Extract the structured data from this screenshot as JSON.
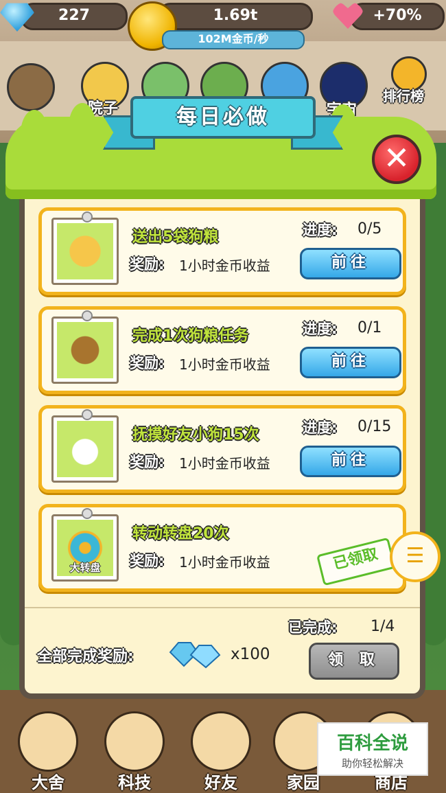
{
  "top": {
    "diamonds": "227",
    "coins": "1.69t",
    "rate": "102M金币/秒",
    "bonus": "+70%"
  },
  "side": {
    "left_label": "院子",
    "right_label": "宇宙",
    "ranking_label": "排行榜"
  },
  "dialog": {
    "title": "每日必做",
    "close_glyph": "✕"
  },
  "tasks": [
    {
      "title": "送出5袋狗粮",
      "reward_label": "奖励:",
      "reward": "1小时金币收益",
      "progress_label": "进度:",
      "progress": "0/5",
      "action": "前往",
      "icon": "dog-food-bags-icon"
    },
    {
      "title": "完成1次狗粮任务",
      "reward_label": "奖励:",
      "reward": "1小时金币收益",
      "progress_label": "进度:",
      "progress": "0/1",
      "action": "前往",
      "icon": "dog-food-bag-icon"
    },
    {
      "title": "抚摸好友小狗15次",
      "reward_label": "奖励:",
      "reward": "1小时金币收益",
      "progress_label": "进度:",
      "progress": "0/15",
      "action": "前往",
      "icon": "puppy-icon"
    },
    {
      "title": "转动转盘20次",
      "reward_label": "奖励:",
      "reward": "1小时金币收益",
      "status": "已领取",
      "icon": "wheel-icon",
      "icon_caption": "大转盘"
    }
  ],
  "summary": {
    "done_label": "已完成:",
    "done_value": "1/4",
    "all_reward_label": "全部完成奖励:",
    "gem_qty": "x100",
    "claim": "领 取"
  },
  "menu_glyph": "☰",
  "bottom_nav": [
    {
      "label": "大舍"
    },
    {
      "label": "科技"
    },
    {
      "label": "好友"
    },
    {
      "label": "家园"
    },
    {
      "label": "商店"
    }
  ],
  "watermark": {
    "title": "百科全说",
    "subtitle": "助你轻松解决"
  },
  "colors": {
    "card_border": "#f2b31c",
    "go_button": "#35a8e8",
    "claimed": "#5bbd2a",
    "title_green": "#c1e53c"
  }
}
